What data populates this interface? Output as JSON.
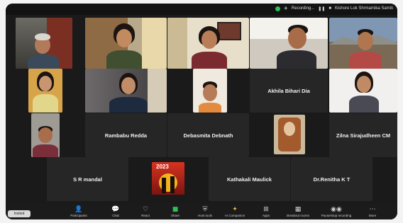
{
  "window": {
    "status_text": "Recording...",
    "title": "Kishore Lok Shrmamika Samiti",
    "accent_green": "#2fbf57"
  },
  "gallery": {
    "participants_row3": [
      {
        "name": "Akhila Bihari Dia"
      }
    ],
    "participants_row4": [
      {
        "name": "Rambabu Redda"
      },
      {
        "name": "Debasmita Debnath"
      },
      {
        "name": "Zilna Sirajudheen CM"
      }
    ],
    "participants_row5": [
      {
        "name": "S R mandal"
      },
      {
        "name": "Kathakali Maulick"
      },
      {
        "name": "Dr.Renitha K T"
      }
    ],
    "poster_text": "2023"
  },
  "toolbar": {
    "items": [
      {
        "label": "Participants",
        "icon": "participants-icon"
      },
      {
        "label": "Chat",
        "icon": "chat-icon"
      },
      {
        "label": "React",
        "icon": "react-icon"
      },
      {
        "label": "Share",
        "icon": "share-icon"
      },
      {
        "label": "Host tools",
        "icon": "host-tools-icon"
      },
      {
        "label": "AI Companion",
        "icon": "ai-companion-icon"
      },
      {
        "label": "Apps",
        "icon": "apps-icon"
      },
      {
        "label": "Breakout rooms",
        "icon": "breakout-rooms-icon"
      },
      {
        "label": "Pause/stop recording",
        "icon": "recording-icon"
      },
      {
        "label": "More",
        "icon": "more-icon"
      }
    ],
    "badge_label": "Invited"
  }
}
